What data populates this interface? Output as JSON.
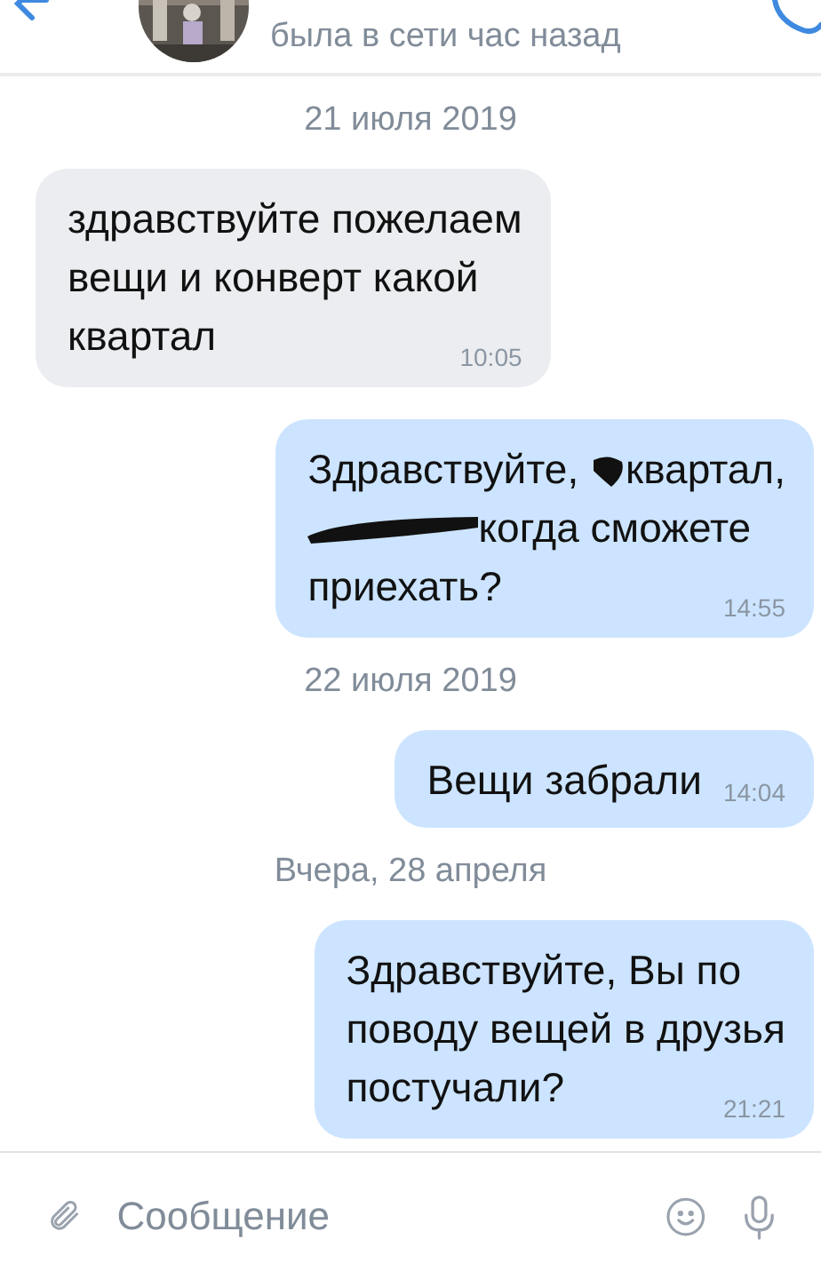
{
  "header": {
    "status": "была в сети час назад"
  },
  "feed": [
    {
      "kind": "date",
      "text": "21 июля 2019"
    },
    {
      "kind": "message",
      "outgoing": false,
      "time": "10:05",
      "lines": [
        [
          {
            "kind": "text",
            "text": "здравствуйте пожелаем"
          }
        ],
        [
          {
            "kind": "text",
            "text": "вещи и конверт какой"
          }
        ],
        [
          {
            "kind": "text",
            "text": "квартал"
          }
        ]
      ]
    },
    {
      "kind": "message",
      "outgoing": true,
      "time": "14:55",
      "lines": [
        [
          {
            "kind": "text",
            "text": "Здравствуйте, "
          },
          {
            "kind": "redaction",
            "wide": false
          },
          {
            "kind": "text",
            "text": "квартал,"
          }
        ],
        [
          {
            "kind": "redaction",
            "wide": true
          },
          {
            "kind": "text",
            "text": "когда сможете"
          }
        ],
        [
          {
            "kind": "text",
            "text": "приехать?"
          }
        ]
      ]
    },
    {
      "kind": "date",
      "text": "22 июля 2019"
    },
    {
      "kind": "message",
      "outgoing": true,
      "time": "14:04",
      "inline": true,
      "lines": [
        [
          {
            "kind": "text",
            "text": "Вещи забрали"
          }
        ]
      ]
    },
    {
      "kind": "date",
      "text": "Вчера, 28 апреля"
    },
    {
      "kind": "message",
      "outgoing": true,
      "time": "21:21",
      "lines": [
        [
          {
            "kind": "text",
            "text": "Здравствуйте, Вы по"
          }
        ],
        [
          {
            "kind": "text",
            "text": "поводу вещей в друзья"
          }
        ],
        [
          {
            "kind": "text",
            "text": "постучали?"
          }
        ]
      ]
    }
  ],
  "composer": {
    "placeholder": "Сообщение"
  }
}
